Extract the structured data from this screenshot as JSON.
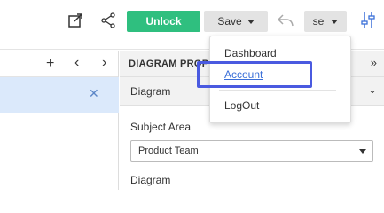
{
  "toolbar": {
    "unlock_label": "Unlock",
    "save_label": "Save",
    "user_label": "se",
    "accent_color": "#2fbf7f"
  },
  "right_panel": {
    "title": "DIAGRAM PROPE",
    "section_label": "Diagram",
    "subject_area_label": "Subject Area",
    "subject_area_value": "Product Team",
    "diagram_label": "Diagram"
  },
  "menu": {
    "items": [
      {
        "label": "Dashboard"
      },
      {
        "label": "Account"
      },
      {
        "label": "LogOut"
      }
    ]
  },
  "icons": {
    "external": "external-link-icon",
    "share": "share-icon",
    "undo": "undo-icon",
    "settings": "sliders-icon",
    "plus": "plus-icon",
    "prev": "chevron-left-icon",
    "next": "chevron-right-icon",
    "close": "close-icon"
  }
}
